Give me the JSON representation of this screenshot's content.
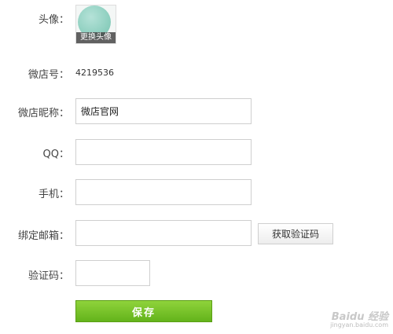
{
  "form": {
    "avatar": {
      "label": "头像：",
      "change_caption": "更换头像"
    },
    "shop_id": {
      "label": "微店号：",
      "value": "4219536"
    },
    "shop_nickname": {
      "label": "微店昵称：",
      "value": "微店官网"
    },
    "qq": {
      "label": "QQ：",
      "value": ""
    },
    "phone": {
      "label": "手机：",
      "value": ""
    },
    "email": {
      "label": "绑定邮箱：",
      "value": "",
      "get_code_label": "获取验证码"
    },
    "verify_code": {
      "label": "验证码：",
      "value": ""
    },
    "save_label": "保存"
  },
  "watermark": {
    "main": "Baidu 经验",
    "sub": "jingyan.baidu.com"
  }
}
